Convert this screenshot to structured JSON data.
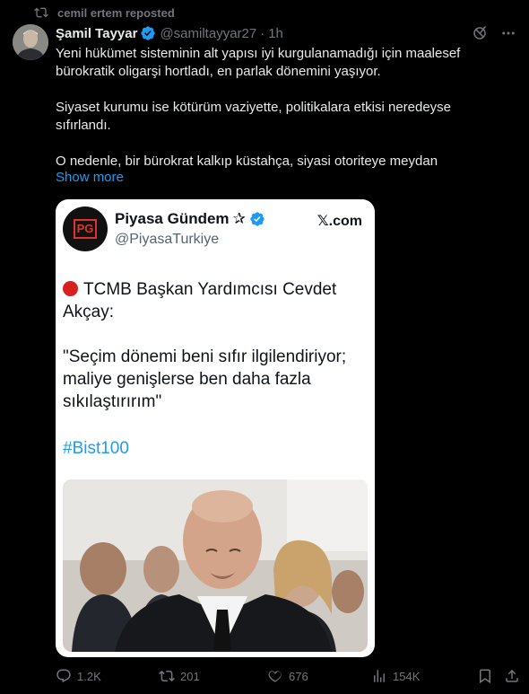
{
  "repost": {
    "text": "cemil ertem reposted"
  },
  "tweet": {
    "author_name": "Şamil Tayyar",
    "handle": "@samiltayyar27",
    "separator": "·",
    "time": "1h",
    "paragraphs": [
      "Yeni hükümet sisteminin alt yapısı iyi kurgulanamadığı için maalesef bürokratik oligarşi hortladı, en parlak dönemini yaşıyor.",
      "Siyaset kurumu ise kötürüm vaziyette, politikalara etkisi neredeyse sıfırlandı.",
      "O nedenle, bir bürokrat kalkıp küstahça, siyasi otoriteye meydan"
    ],
    "show_more": "Show more"
  },
  "card": {
    "logo_text": "PG",
    "name": "Piyasa Gündem",
    "star": "✰",
    "handle": "@PiyasaTurkiye",
    "source": "𝕏.com",
    "headline": "TCMB Başkan Yardımcısı Cevdet Akçay:",
    "quote": "\"Seçim dönemi beni sıfır ilgilendiriyor; maliye genişlerse ben daha fazla sıkılaştırırım\"",
    "hashtag": "#Bist100"
  },
  "actions": {
    "replies": "1.2K",
    "reposts": "201",
    "likes": "676",
    "views": "154K"
  },
  "colors": {
    "background": "#000000",
    "text": "#e7e9ea",
    "muted": "#71767b",
    "link": "#1d9bf0",
    "verified": "#1d9bf0"
  }
}
